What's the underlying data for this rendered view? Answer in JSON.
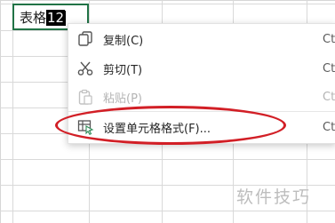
{
  "sheet": {
    "active_cell": {
      "text_plain": "表格",
      "text_selected": "12"
    }
  },
  "context_menu": {
    "items": [
      {
        "label": "复制(C)",
        "shortcut": "Ct",
        "icon": "copy-icon",
        "disabled": false
      },
      {
        "label": "剪切(T)",
        "shortcut": "Ctr",
        "icon": "scissors-icon",
        "disabled": false
      },
      {
        "label": "粘贴(P)",
        "shortcut": "Ctr",
        "icon": "paste-icon",
        "disabled": true
      },
      {
        "label": "设置单元格格式(F)...",
        "shortcut": "Ct",
        "icon": "format-cells-icon",
        "disabled": false
      }
    ]
  },
  "annotation": {
    "color": "#d21f26"
  },
  "watermark": {
    "text": "软件技巧"
  },
  "colors": {
    "active_cell_border": "#217346",
    "gridline": "#d9d9d9"
  }
}
